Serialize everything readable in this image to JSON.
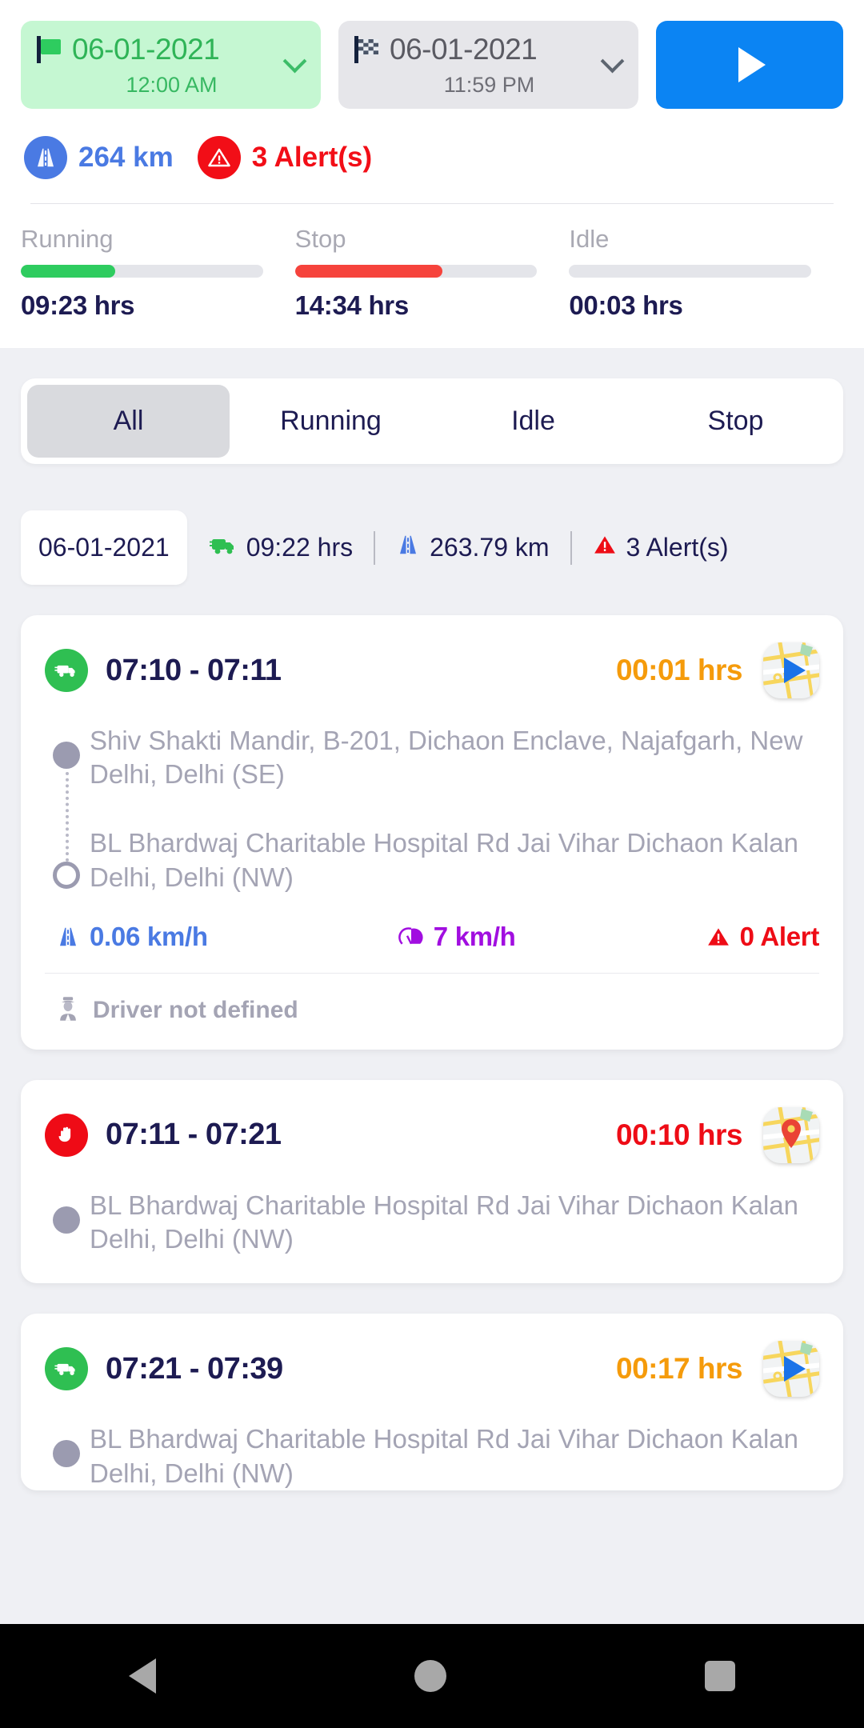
{
  "header": {
    "start_chip": {
      "icon": "green-flag-icon",
      "date": "06-01-2021",
      "time": "12:00 AM"
    },
    "end_chip": {
      "icon": "checkered-flag-icon",
      "date": "06-01-2021",
      "time": "11:59 PM"
    },
    "play_button_label": "▶",
    "kpis": [
      {
        "icon": "road-icon",
        "value": "264 km",
        "color": "#4a7ae3"
      },
      {
        "icon": "alert-triangle-icon",
        "value": "3 Alert(s)",
        "color": "#f20e17"
      }
    ],
    "statuses": [
      {
        "label": "Running",
        "value": "09:23 hrs",
        "percent": 39,
        "color": "#2ecc5f"
      },
      {
        "label": "Stop",
        "value": "14:34 hrs",
        "percent": 61,
        "color": "#f6433c"
      },
      {
        "label": "Idle",
        "value": "00:03 hrs",
        "percent": 0,
        "color": "#e4e5ea"
      }
    ]
  },
  "tabs": [
    {
      "label": "All",
      "active": true
    },
    {
      "label": "Running",
      "active": false
    },
    {
      "label": "Idle",
      "active": false
    },
    {
      "label": "Stop",
      "active": false
    }
  ],
  "summary": {
    "date": "06-01-2021",
    "duration": "09:22 hrs",
    "distance": "263.79 km",
    "alerts": "3 Alert(s)"
  },
  "trips": [
    {
      "state": "running",
      "state_icon": "truck-icon",
      "time_range": "07:10 - 07:11",
      "duration": "00:01 hrs",
      "duration_color": "#f59b0b",
      "map_icon": "map-route-play-icon",
      "addresses": [
        "Shiv Shakti Mandir, B-201, Dichaon Enclave, Najafgarh, New Delhi, Delhi (SE)",
        "BL Bhardwaj Charitable Hospital Rd Jai Vihar Dichaon Kalan Delhi, Delhi (NW)"
      ],
      "metrics": [
        {
          "icon": "road-icon",
          "value": "0.06 km/h",
          "color": "#4a7ae3"
        },
        {
          "icon": "speedometer-icon",
          "value": "7 km/h",
          "color": "#a10ee0"
        },
        {
          "icon": "alert-triangle-icon",
          "value": "0 Alert",
          "color": "#ee0c16"
        }
      ],
      "driver": "Driver not defined"
    },
    {
      "state": "stop",
      "state_icon": "hand-stop-icon",
      "time_range": "07:11 - 07:21",
      "duration": "00:10 hrs",
      "duration_color": "#ee0c16",
      "map_icon": "map-pin-icon",
      "addresses": [
        "BL Bhardwaj Charitable Hospital Rd Jai Vihar Dichaon Kalan Delhi, Delhi (NW)"
      ]
    },
    {
      "state": "running",
      "state_icon": "truck-icon",
      "time_range": "07:21 - 07:39",
      "duration": "00:17 hrs",
      "duration_color": "#f59b0b",
      "map_icon": "map-route-play-icon",
      "addresses": [
        "BL Bhardwaj Charitable Hospital Rd Jai Vihar Dichaon Kalan Delhi, Delhi (NW)"
      ]
    }
  ],
  "navbar": {
    "back": "back-triangle",
    "home": "home-circle",
    "recents": "recents-square"
  }
}
